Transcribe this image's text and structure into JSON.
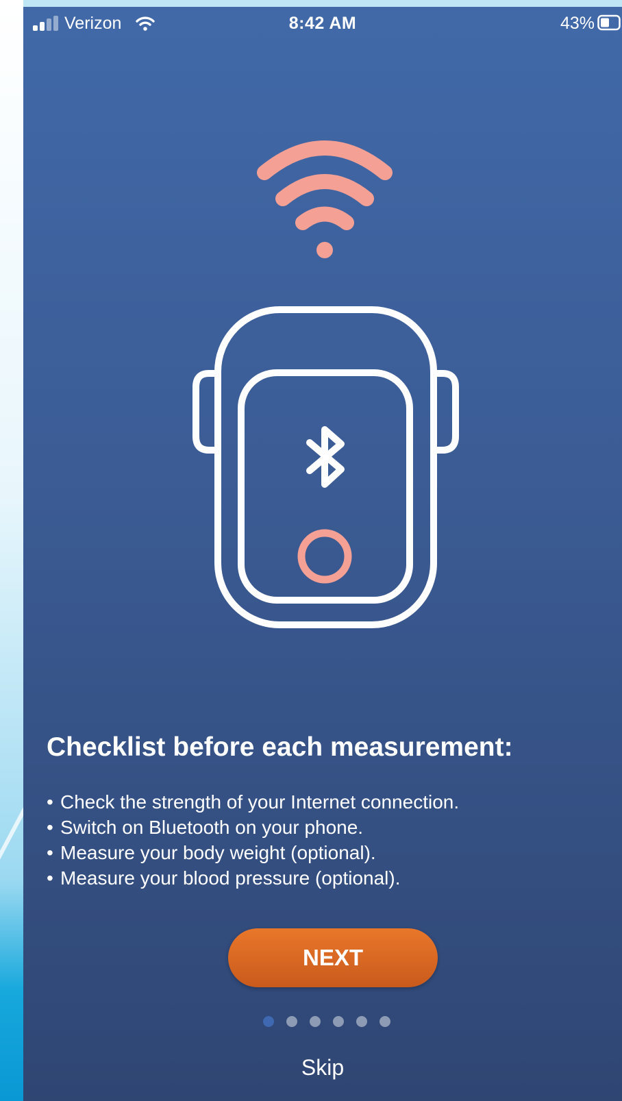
{
  "status_bar": {
    "carrier": "Verizon",
    "time": "8:42 AM",
    "battery_percent": "43%",
    "signal_bars": 2,
    "icons": [
      "signal-icon",
      "wifi-icon",
      "battery-icon"
    ]
  },
  "illustration": {
    "icons": [
      "wifi-signal-icon",
      "device-icon",
      "bluetooth-icon",
      "power-button-icon"
    ],
    "colors": {
      "accent": "#f4a094",
      "outline": "#ffffff"
    }
  },
  "onboarding": {
    "title": "Checklist before each measurement:",
    "items": [
      "Check the strength of your Internet connection.",
      "Switch on Bluetooth on your phone.",
      "Measure your body weight (optional).",
      "Measure your blood pressure (optional)."
    ],
    "next_label": "NEXT",
    "skip_label": "Skip",
    "page_count": 6,
    "current_page": 1
  },
  "colors": {
    "background_top": "#4169a8",
    "background_bottom": "#2f4673",
    "button": "#e0692a",
    "active_dot": "#3e68b0"
  }
}
